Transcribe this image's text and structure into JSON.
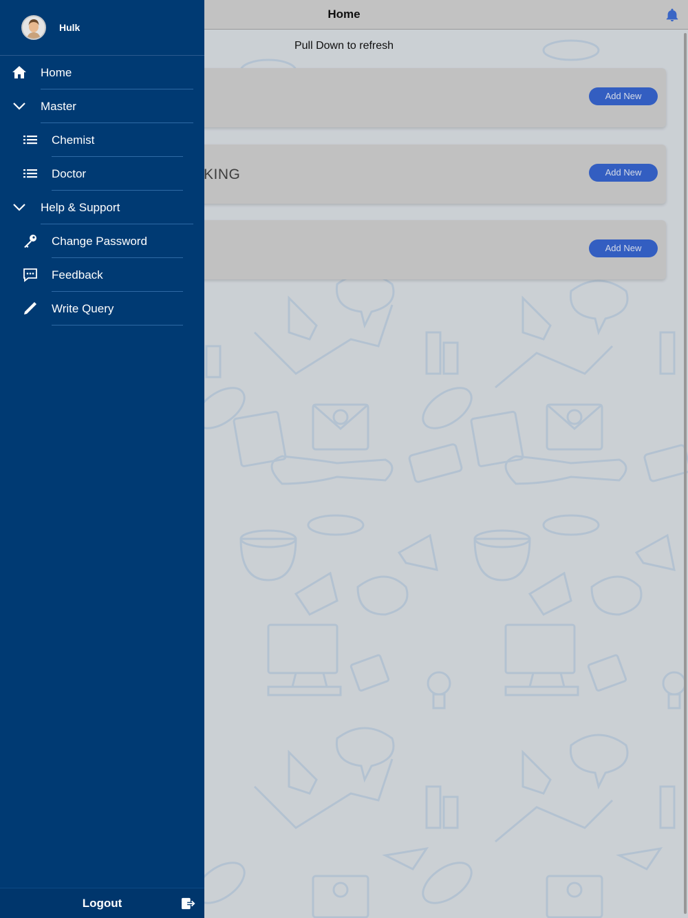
{
  "header": {
    "title": "Home"
  },
  "main": {
    "pull_to_refresh": "Pull Down to refresh",
    "cards": [
      {
        "title": "",
        "button_label": "Add New"
      },
      {
        "title": "KING",
        "button_label": "Add New"
      },
      {
        "title": "",
        "button_label": "Add New"
      }
    ]
  },
  "drawer": {
    "user_name": "Hulk",
    "items": [
      {
        "label": "Home",
        "icon": "home-icon"
      },
      {
        "label": "Master",
        "icon": "chevron-down-icon"
      },
      {
        "label": "Chemist",
        "icon": "list-icon"
      },
      {
        "label": "Doctor",
        "icon": "list-icon"
      },
      {
        "label": "Help & Support",
        "icon": "chevron-down-icon"
      },
      {
        "label": "Change Password",
        "icon": "key-icon"
      },
      {
        "label": "Feedback",
        "icon": "chat-icon"
      },
      {
        "label": "Write Query",
        "icon": "pencil-icon"
      }
    ],
    "logout_label": "Logout"
  },
  "colors": {
    "drawer_bg": "#003a73",
    "accent_button": "#3867d2",
    "notification_bell": "#3f6fd6",
    "pattern_stroke": "#bfd0e2"
  }
}
